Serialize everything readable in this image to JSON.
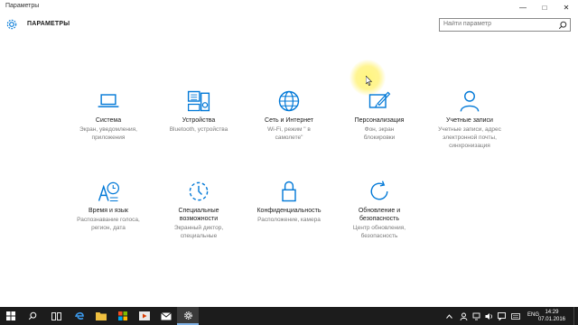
{
  "window": {
    "title": "Параметры",
    "min_label": "—",
    "max_label": "□",
    "close_label": "✕"
  },
  "header": {
    "title": "ПАРАМЕТРЫ",
    "gear_icon": "gear-icon"
  },
  "search": {
    "placeholder": "Найти параметр",
    "icon": "search-icon"
  },
  "tiles": [
    {
      "name": "Система",
      "desc": "Экран, уведомления,\nприложения",
      "icon": "laptop-icon"
    },
    {
      "name": "Устройства",
      "desc": "Bluetooth, устройства",
      "icon": "devices-icon"
    },
    {
      "name": "Сеть и Интернет",
      "desc": "Wi-Fi, режим \" в\nсамолете\"",
      "icon": "globe-icon"
    },
    {
      "name": "Персонализация",
      "desc": "Фон, экран\nблокировки",
      "icon": "personalization-icon"
    },
    {
      "name": "Учетные записи",
      "desc": "Учетные записи, адрес\nэлектронной почты,\nсинхронизация",
      "icon": "user-icon"
    },
    {
      "name": "Время и язык",
      "desc": "Распознавание голоса,\nрегион, дата",
      "icon": "time-language-icon"
    },
    {
      "name": "Специальные\nвозможности",
      "desc": "Экранный диктор,\nспециальные",
      "icon": "accessibility-icon"
    },
    {
      "name": "Конфиденциальность",
      "desc": "Расположение, камера",
      "icon": "lock-icon"
    },
    {
      "name": "Обновление и\nбезопасность",
      "desc": "Центр обновления,\nбезопасность",
      "icon": "update-icon"
    }
  ],
  "taskbar": {
    "items": [
      "start-icon",
      "search-icon",
      "task-view-icon",
      "edge-icon",
      "explorer-icon",
      "store-icon",
      "media-icon",
      "mail-icon",
      "settings-icon"
    ],
    "language": "ENG",
    "time": "14:29",
    "date": "07.01.2016"
  },
  "colors": {
    "accent": "#0078d7",
    "taskbar": "#1c1c1c"
  }
}
